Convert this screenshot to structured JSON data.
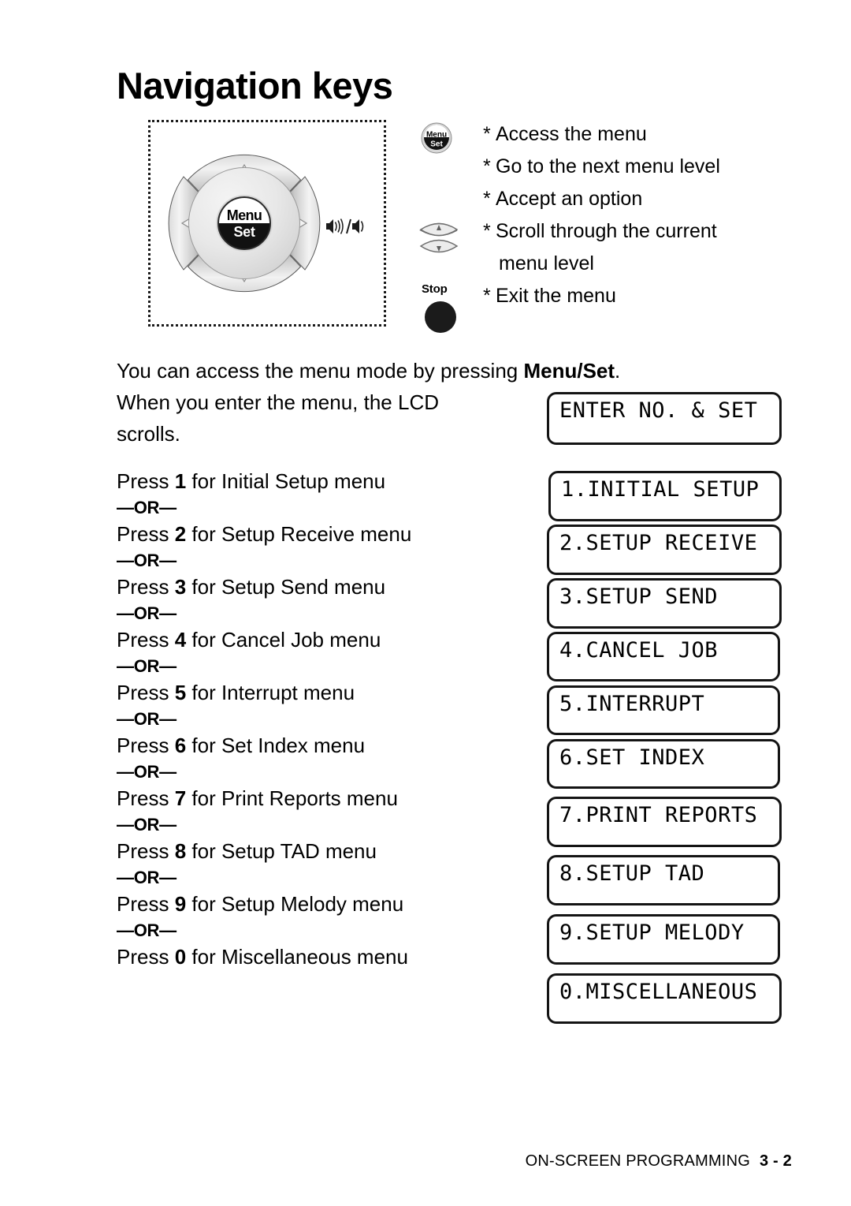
{
  "page": {
    "title": "Navigation keys",
    "footer_label": "ON-SCREEN PROGRAMMING",
    "footer_page": "3 - 2"
  },
  "navpad": {
    "center_top_label": "Menu",
    "center_bottom_label": "Set",
    "up_arrow": "up-triangle",
    "down_arrow": "down-triangle",
    "left_arrow": "left-triangle",
    "right_arrow": "right-triangle",
    "volume_icon_label": "speaker-up / speaker-down"
  },
  "legend": {
    "menuset_icon_top": "Menu",
    "menuset_icon_bottom": "Set",
    "stop_label": "Stop",
    "bullets": [
      {
        "star": "*",
        "text": "Access the menu"
      },
      {
        "star": "*",
        "text": "Go to the next menu level"
      },
      {
        "star": "*",
        "text": "Accept an option"
      },
      {
        "star": "*",
        "text": "Scroll through the current"
      }
    ],
    "scroll_continuation": "menu level",
    "exit_bullet": {
      "star": "*",
      "text": "Exit the menu"
    }
  },
  "intro": {
    "line1_pre": "You can access the menu mode by pressing ",
    "line1_bold": "Menu/Set",
    "line1_post": ".",
    "line2": "When you enter the menu, the LCD",
    "line3": "scrolls."
  },
  "enter_lcd": "ENTER NO. & SET",
  "or_label": "—OR—",
  "menu_items": [
    {
      "press_pre": "Press ",
      "key": "1",
      "press_post": " for Initial Setup menu",
      "lcd": "1.INITIAL SETUP"
    },
    {
      "press_pre": "Press ",
      "key": "2",
      "press_post": " for Setup Receive menu",
      "lcd": "2.SETUP RECEIVE"
    },
    {
      "press_pre": "Press ",
      "key": "3",
      "press_post": " for Setup Send menu",
      "lcd": "3.SETUP SEND"
    },
    {
      "press_pre": "Press ",
      "key": "4",
      "press_post": " for Cancel Job menu",
      "lcd": "4.CANCEL JOB"
    },
    {
      "press_pre": "Press ",
      "key": "5",
      "press_post": " for Interrupt menu",
      "lcd": "5.INTERRUPT"
    },
    {
      "press_pre": "Press ",
      "key": "6",
      "press_post": " for Set Index menu",
      "lcd": "6.SET INDEX"
    },
    {
      "press_pre": "Press ",
      "key": "7",
      "press_post": " for Print Reports menu",
      "lcd": "7.PRINT REPORTS"
    },
    {
      "press_pre": "Press ",
      "key": "8",
      "press_post": " for Setup TAD menu",
      "lcd": "8.SETUP TAD"
    },
    {
      "press_pre": "Press ",
      "key": "9",
      "press_post": " for Setup Melody menu",
      "lcd": "9.SETUP MELODY"
    },
    {
      "press_pre": "Press ",
      "key": "0",
      "press_post": " for Miscellaneous menu",
      "lcd": "0.MISCELLANEOUS"
    }
  ],
  "colors": {
    "ink": "#000000",
    "paper": "#ffffff",
    "pad_gray": "#d2d2d2",
    "pad_dark": "#9a9a9a"
  }
}
